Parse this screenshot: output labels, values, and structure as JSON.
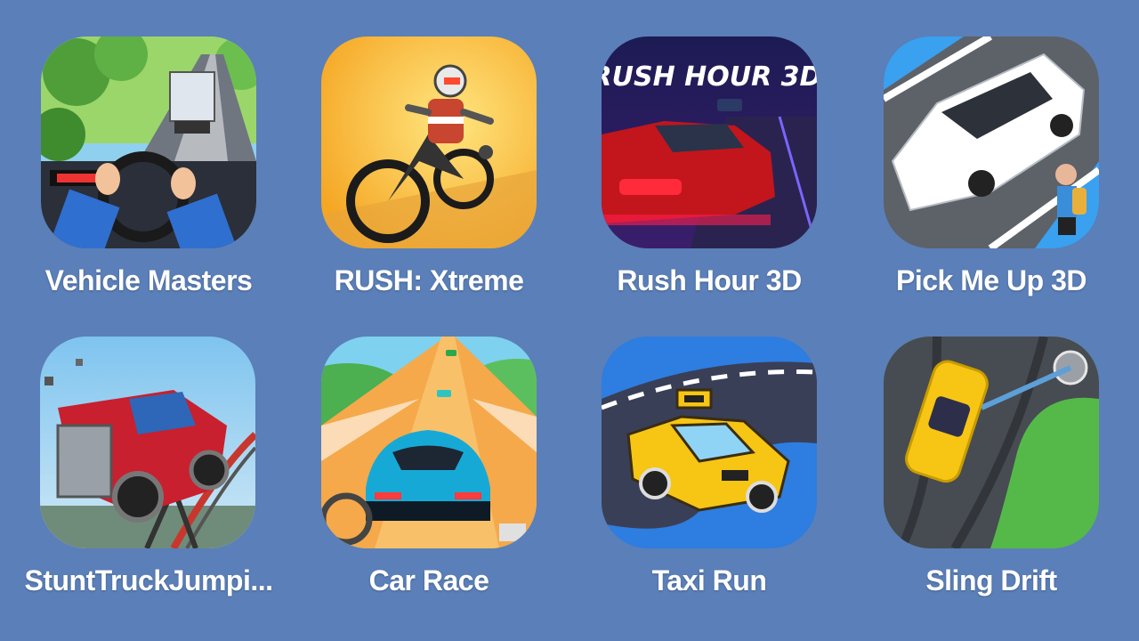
{
  "games": [
    {
      "name": "Vehicle Masters",
      "icon": "vehicle-masters-icon"
    },
    {
      "name": "RUSH: Xtreme",
      "icon": "rush-xtreme-icon"
    },
    {
      "name": "Rush Hour 3D",
      "icon": "rush-hour-3d-icon",
      "icon_text": "RUSH HOUR 3D"
    },
    {
      "name": "Pick Me Up 3D",
      "icon": "pick-me-up-3d-icon"
    },
    {
      "name": "StuntTruckJumpi...",
      "icon": "stunt-truck-jumping-icon"
    },
    {
      "name": "Car Race",
      "icon": "car-race-icon"
    },
    {
      "name": "Taxi Run",
      "icon": "taxi-run-icon"
    },
    {
      "name": "Sling Drift",
      "icon": "sling-drift-icon"
    }
  ],
  "colors": {
    "background": "#5b7fb8",
    "label": "#ffffff"
  }
}
